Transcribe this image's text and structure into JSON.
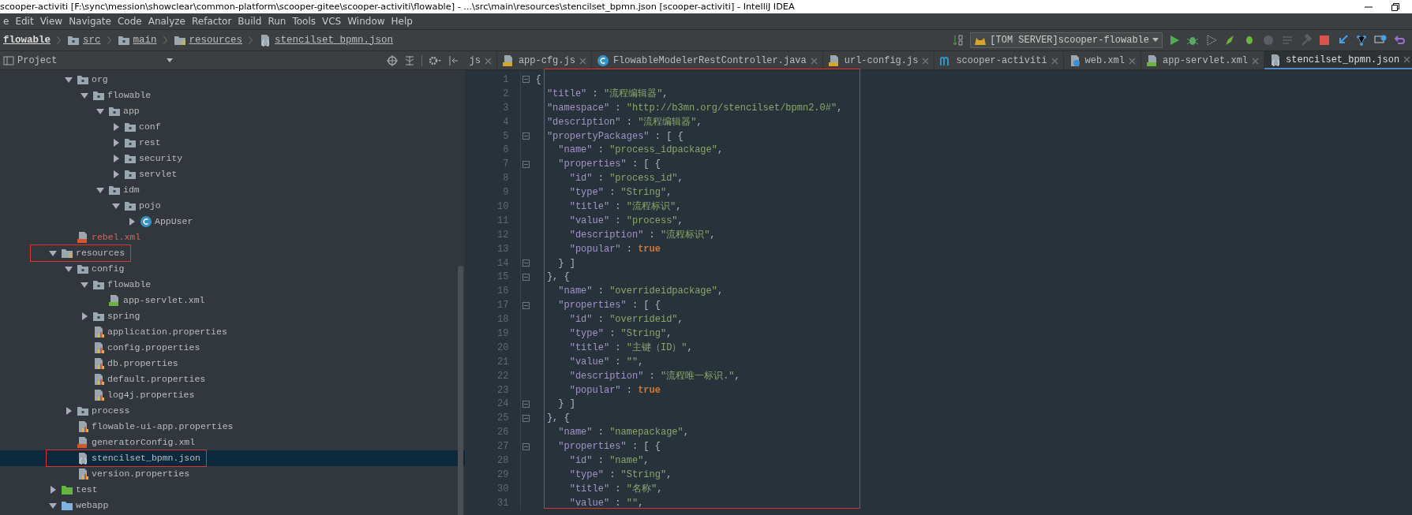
{
  "window": {
    "title": "scooper-activiti [F:\\sync\\mession\\showclear\\common-platform\\scooper-gitee\\scooper-activiti\\flowable] - ...\\src\\main\\resources\\stencilset_bpmn.json [scooper-activiti] - IntelliJ IDEA"
  },
  "menu": [
    "e",
    "Edit",
    "View",
    "Navigate",
    "Code",
    "Analyze",
    "Refactor",
    "Build",
    "Run",
    "Tools",
    "VCS",
    "Window",
    "Help"
  ],
  "breadcrumb": [
    {
      "label": "flowable",
      "kind": "module"
    },
    {
      "label": "src",
      "kind": "folder"
    },
    {
      "label": "main",
      "kind": "folder"
    },
    {
      "label": "resources",
      "kind": "resources"
    },
    {
      "label": "stencilset_bpmn.json",
      "kind": "json"
    }
  ],
  "run_config": "[TOM SERVER]scooper-flowable",
  "project": {
    "title": "Project",
    "tree": {
      "scrolled_parent_children": [
        {
          "label": "org",
          "kind": "folder",
          "expanded": true,
          "selected": false,
          "annotated": false,
          "unversioned": false,
          "children": [
            {
              "label": "flowable",
              "kind": "folder",
              "expanded": true,
              "selected": false,
              "annotated": false,
              "unversioned": false,
              "children": [
                {
                  "label": "app",
                  "kind": "folder",
                  "expanded": true,
                  "selected": false,
                  "annotated": false,
                  "unversioned": false,
                  "children": [
                    {
                      "label": "conf",
                      "kind": "folder",
                      "expanded": false,
                      "selected": false,
                      "annotated": false,
                      "unversioned": false
                    },
                    {
                      "label": "rest",
                      "kind": "folder",
                      "expanded": false,
                      "selected": false,
                      "annotated": false,
                      "unversioned": false
                    },
                    {
                      "label": "security",
                      "kind": "folder",
                      "expanded": false,
                      "selected": false,
                      "annotated": false,
                      "unversioned": false
                    },
                    {
                      "label": "servlet",
                      "kind": "folder",
                      "expanded": false,
                      "selected": false,
                      "annotated": false,
                      "unversioned": false
                    }
                  ]
                },
                {
                  "label": "idm",
                  "kind": "folder",
                  "expanded": true,
                  "selected": false,
                  "annotated": false,
                  "unversioned": false,
                  "children": [
                    {
                      "label": "pojo",
                      "kind": "folder",
                      "expanded": true,
                      "selected": false,
                      "annotated": false,
                      "unversioned": false,
                      "children": [
                        {
                          "label": "AppUser",
                          "kind": "class",
                          "expanded": false,
                          "selected": false,
                          "annotated": false,
                          "unversioned": false
                        }
                      ]
                    }
                  ]
                }
              ]
            }
          ]
        },
        {
          "label": "rebel.xml",
          "kind": "xml",
          "selected": false,
          "annotated": false,
          "unversioned": true
        }
      ],
      "items": [
        {
          "label": "resources",
          "kind": "resources",
          "expanded": true,
          "selected": false,
          "annotated": true,
          "unversioned": false,
          "children": [
            {
              "label": "config",
              "kind": "folder",
              "expanded": true,
              "selected": false,
              "annotated": false,
              "unversioned": false,
              "children": [
                {
                  "label": "flowable",
                  "kind": "folder",
                  "expanded": true,
                  "selected": false,
                  "annotated": false,
                  "unversioned": false,
                  "children": [
                    {
                      "label": "app-servlet.xml",
                      "kind": "spring_xml",
                      "selected": false,
                      "annotated": false,
                      "unversioned": false
                    }
                  ]
                },
                {
                  "label": "spring",
                  "kind": "folder",
                  "expanded": false,
                  "selected": false,
                  "annotated": false,
                  "unversioned": false
                },
                {
                  "label": "application.properties",
                  "kind": "properties",
                  "selected": false,
                  "annotated": false,
                  "unversioned": false
                },
                {
                  "label": "config.properties",
                  "kind": "properties",
                  "selected": false,
                  "annotated": false,
                  "unversioned": false
                },
                {
                  "label": "db.properties",
                  "kind": "properties",
                  "selected": false,
                  "annotated": false,
                  "unversioned": false
                },
                {
                  "label": "default.properties",
                  "kind": "properties",
                  "selected": false,
                  "annotated": false,
                  "unversioned": false
                },
                {
                  "label": "log4j.properties",
                  "kind": "properties",
                  "selected": false,
                  "annotated": false,
                  "unversioned": false
                }
              ]
            },
            {
              "label": "process",
              "kind": "folder",
              "expanded": false,
              "selected": false,
              "annotated": false,
              "unversioned": false
            },
            {
              "label": "flowable-ui-app.properties",
              "kind": "properties",
              "selected": false,
              "annotated": false,
              "unversioned": false
            },
            {
              "label": "generatorConfig.xml",
              "kind": "xml",
              "selected": false,
              "annotated": false,
              "unversioned": false
            },
            {
              "label": "stencilset_bpmn.json",
              "kind": "json",
              "selected": true,
              "annotated": true,
              "unversioned": false
            },
            {
              "label": "version.properties",
              "kind": "properties",
              "selected": false,
              "annotated": false,
              "unversioned": false
            }
          ]
        },
        {
          "label": "test",
          "kind": "test_folder",
          "expanded": false,
          "selected": false,
          "annotated": false,
          "unversioned": false
        },
        {
          "label": "webapp",
          "kind": "web_folder",
          "expanded": true,
          "selected": false,
          "annotated": false,
          "unversioned": false
        }
      ]
    }
  },
  "tabs": [
    {
      "label": "js",
      "selected": false
    },
    {
      "label": "app-cfg.js",
      "kind": "js",
      "selected": false
    },
    {
      "label": "FlowableModelerRestController.java",
      "kind": "class",
      "selected": false
    },
    {
      "label": "url-config.js",
      "kind": "js",
      "selected": false
    },
    {
      "label": "scooper-activiti",
      "kind": "maven",
      "selected": false
    },
    {
      "label": "web.xml",
      "kind": "web_xml",
      "selected": false
    },
    {
      "label": "app-servlet.xml",
      "kind": "spring_xml",
      "selected": false
    },
    {
      "label": "stencilset_bpmn.json",
      "kind": "json",
      "selected": true
    }
  ],
  "editor": {
    "annotation_box": true,
    "lines": [
      {
        "number": "1",
        "text": "{",
        "fold": true
      },
      {
        "number": "2",
        "text": "  \"title\" : \"流程编辑器\",",
        "fold": false
      },
      {
        "number": "3",
        "text": "  \"namespace\" : \"http://b3mn.org/stencilset/bpmn2.0#\",",
        "fold": false
      },
      {
        "number": "4",
        "text": "  \"description\" : \"流程编辑器\",",
        "fold": false
      },
      {
        "number": "5",
        "text": "  \"propertyPackages\" : [ {",
        "fold": true
      },
      {
        "number": "6",
        "text": "    \"name\" : \"process_idpackage\",",
        "fold": false
      },
      {
        "number": "7",
        "text": "    \"properties\" : [ {",
        "fold": true
      },
      {
        "number": "8",
        "text": "      \"id\" : \"process_id\",",
        "fold": false
      },
      {
        "number": "9",
        "text": "      \"type\" : \"String\",",
        "fold": false
      },
      {
        "number": "10",
        "text": "      \"title\" : \"流程标识\",",
        "fold": false
      },
      {
        "number": "11",
        "text": "      \"value\" : \"process\",",
        "fold": false
      },
      {
        "number": "12",
        "text": "      \"description\" : \"流程标识\",",
        "fold": false
      },
      {
        "number": "13",
        "text": "      \"popular\" : true",
        "fold": false
      },
      {
        "number": "14",
        "text": "    } ]",
        "fold": true
      },
      {
        "number": "15",
        "text": "  }, {",
        "fold": true
      },
      {
        "number": "16",
        "text": "    \"name\" : \"overrideidpackage\",",
        "fold": false
      },
      {
        "number": "17",
        "text": "    \"properties\" : [ {",
        "fold": true
      },
      {
        "number": "18",
        "text": "      \"id\" : \"overrideid\",",
        "fold": false
      },
      {
        "number": "19",
        "text": "      \"type\" : \"String\",",
        "fold": false
      },
      {
        "number": "20",
        "text": "      \"title\" : \"主键（ID）\",",
        "fold": false
      },
      {
        "number": "21",
        "text": "      \"value\" : \"\",",
        "fold": false
      },
      {
        "number": "22",
        "text": "      \"description\" : \"流程唯一标识.\",",
        "fold": false
      },
      {
        "number": "23",
        "text": "      \"popular\" : true",
        "fold": false
      },
      {
        "number": "24",
        "text": "    } ]",
        "fold": true
      },
      {
        "number": "25",
        "text": "  }, {",
        "fold": true
      },
      {
        "number": "26",
        "text": "    \"name\" : \"namepackage\",",
        "fold": false
      },
      {
        "number": "27",
        "text": "    \"properties\" : [ {",
        "fold": true
      },
      {
        "number": "28",
        "text": "      \"id\" : \"name\",",
        "fold": false
      },
      {
        "number": "29",
        "text": "      \"type\" : \"String\",",
        "fold": false
      },
      {
        "number": "30",
        "text": "      \"title\" : \"名称\",",
        "fold": false
      },
      {
        "number": "31",
        "text": "      \"value\" : \"\",",
        "fold": false
      }
    ]
  }
}
